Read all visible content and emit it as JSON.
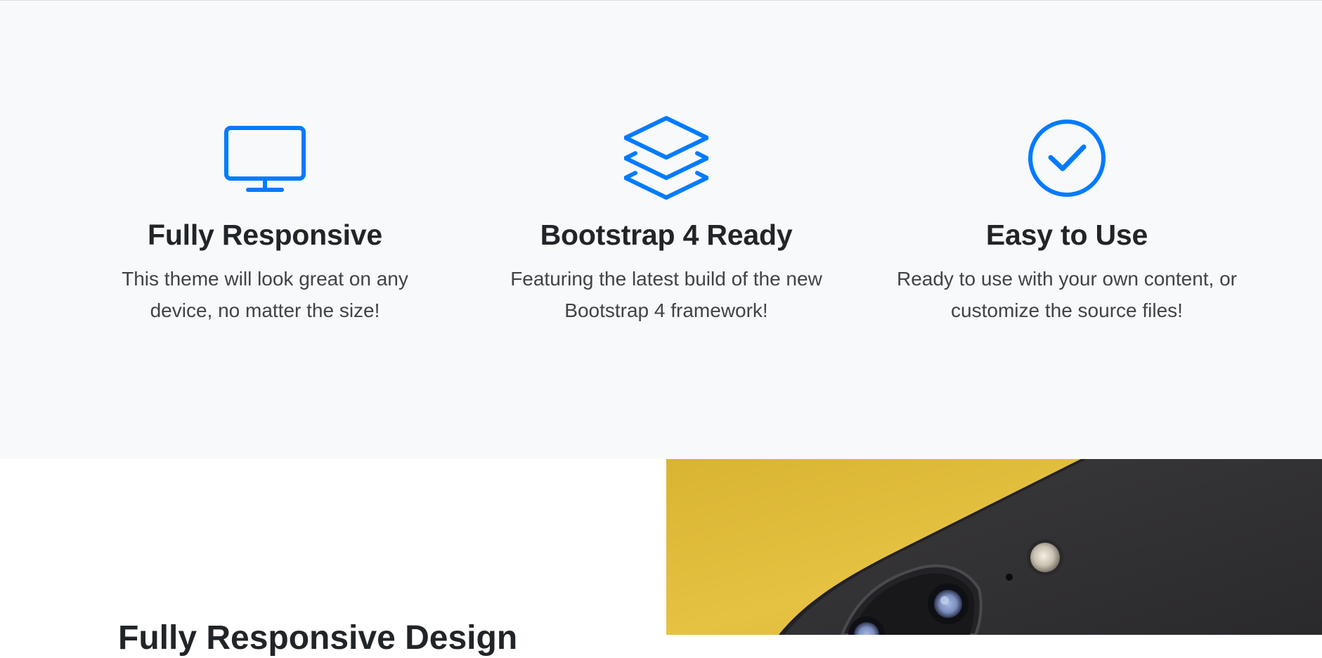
{
  "features": [
    {
      "icon": "monitor-icon",
      "title": "Fully Responsive",
      "text": "This theme will look great on any device, no matter the size!"
    },
    {
      "icon": "layers-icon",
      "title": "Bootstrap 4 Ready",
      "text": "Featuring the latest build of the new Bootstrap 4 framework!"
    },
    {
      "icon": "check-circle-icon",
      "title": "Easy to Use",
      "text": "Ready to use with your own content, or customize the source files!"
    }
  ],
  "showcase": {
    "heading": "Fully Responsive Design",
    "image": "phone-camera-photo"
  },
  "colors": {
    "accent": "#007bff",
    "section_bg": "#f8f9fa",
    "heading": "#212529",
    "body_text": "#3f4448",
    "photo_yellow": "#e0bb37",
    "phone_body": "#2e2d30"
  }
}
